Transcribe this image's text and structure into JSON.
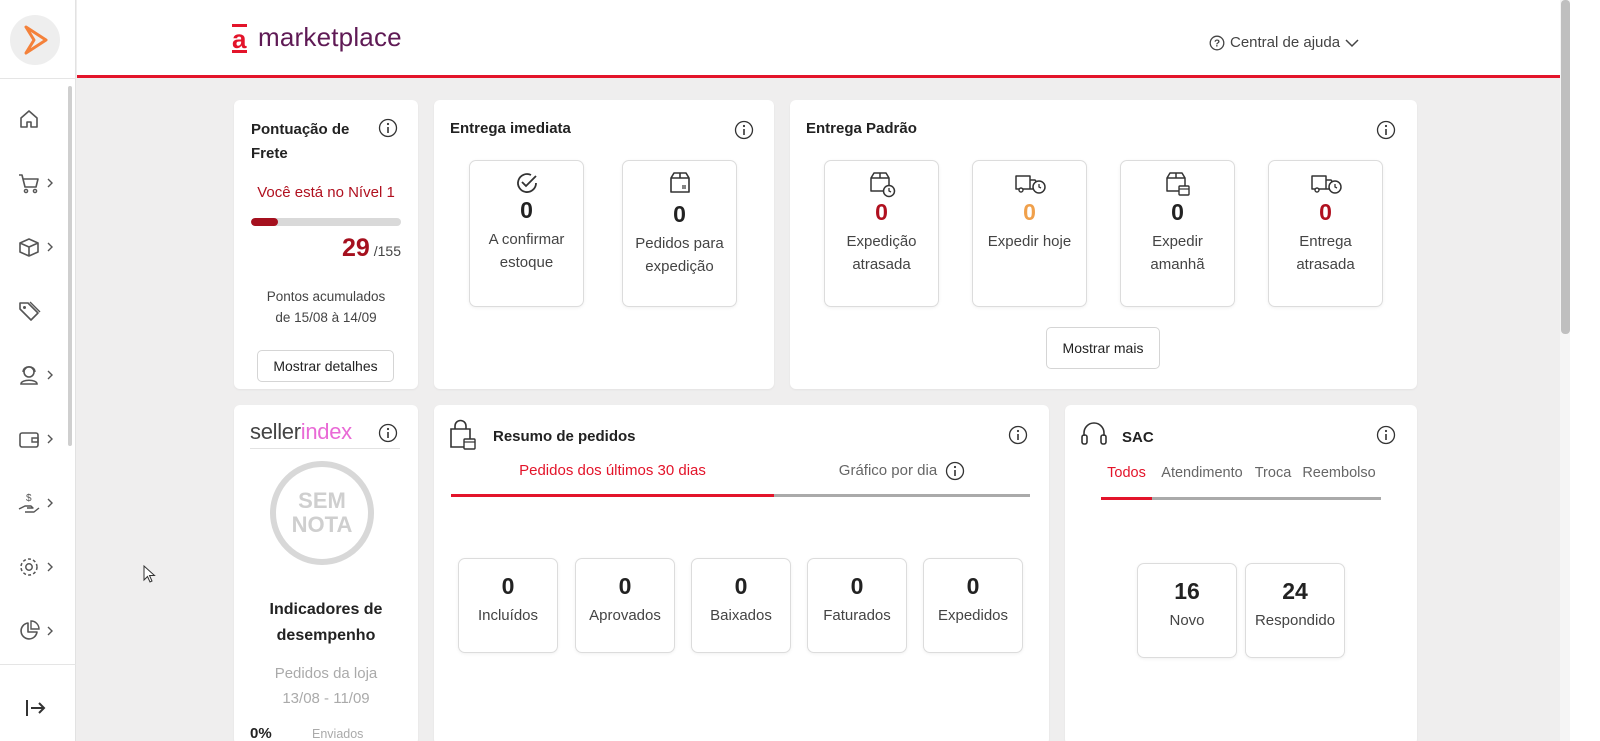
{
  "colors": {
    "accent": "#e3142a",
    "brand": "#5f1a55",
    "warning": "#f0a04b",
    "danger": "#b0101f"
  },
  "header": {
    "brand_letter": "a",
    "brand_name": "marketplace",
    "help_label": "Central de ajuda"
  },
  "sidebar": {
    "items": [
      {
        "icon": "home-icon"
      },
      {
        "icon": "cart-icon"
      },
      {
        "icon": "box-icon"
      },
      {
        "icon": "tag-icon"
      },
      {
        "icon": "support-agent-icon"
      },
      {
        "icon": "wallet-icon"
      },
      {
        "icon": "payment-hand-icon"
      },
      {
        "icon": "gear-icon"
      },
      {
        "icon": "pie-chart-icon"
      }
    ],
    "collapse_icon": "collapse-icon"
  },
  "frete": {
    "title": "Pontuação de Frete",
    "level_text": "Você está no Nível 1",
    "score": "29",
    "total": "/155",
    "progress": 0.18,
    "period_label": "Pontos acumulados",
    "period_range": "de 15/08 à 14/09",
    "details_button": "Mostrar detalhes"
  },
  "entrega_imediata": {
    "title": "Entrega imediata",
    "tiles": [
      {
        "value": "0",
        "label": "A confirmar estoque",
        "icon": "check-circle-icon"
      },
      {
        "value": "0",
        "label": "Pedidos para expedição",
        "icon": "package-icon"
      }
    ]
  },
  "entrega_padrao": {
    "title": "Entrega Padrão",
    "tiles": [
      {
        "value": "0",
        "label": "Expedição atrasada",
        "icon": "package-clock-icon",
        "color": "#b0101f"
      },
      {
        "value": "0",
        "label": "Expedir hoje",
        "icon": "truck-clock-icon",
        "color": "#f0a04b"
      },
      {
        "value": "0",
        "label": "Expedir amanhã",
        "icon": "package-calendar-icon",
        "color": "#222222"
      },
      {
        "value": "0",
        "label": "Entrega atrasada",
        "icon": "truck-late-icon",
        "color": "#b0101f"
      }
    ],
    "more_button": "Mostrar mais"
  },
  "sellerindex": {
    "logo_seller": "seller",
    "logo_index": "index",
    "badge_line1": "SEM",
    "badge_line2": "NOTA",
    "title": "Indicadores de desempenho",
    "subtitle": "Pedidos da loja",
    "range": "13/08 - 11/09",
    "percent": "0%",
    "percent_label": "Enviados"
  },
  "resumo": {
    "title": "Resumo de pedidos",
    "tabs": [
      "Pedidos dos últimos 30 dias",
      "Gráfico por dia"
    ],
    "active_tab": 0,
    "tiles": [
      {
        "value": "0",
        "label": "Incluídos"
      },
      {
        "value": "0",
        "label": "Aprovados"
      },
      {
        "value": "0",
        "label": "Baixados"
      },
      {
        "value": "0",
        "label": "Faturados"
      },
      {
        "value": "0",
        "label": "Expedidos"
      }
    ]
  },
  "sac": {
    "title": "SAC",
    "tabs": [
      "Todos",
      "Atendimento",
      "Troca",
      "Reembolso"
    ],
    "active_tab": 0,
    "tiles": [
      {
        "value": "16",
        "label": "Novo"
      },
      {
        "value": "24",
        "label": "Respondido"
      }
    ]
  }
}
